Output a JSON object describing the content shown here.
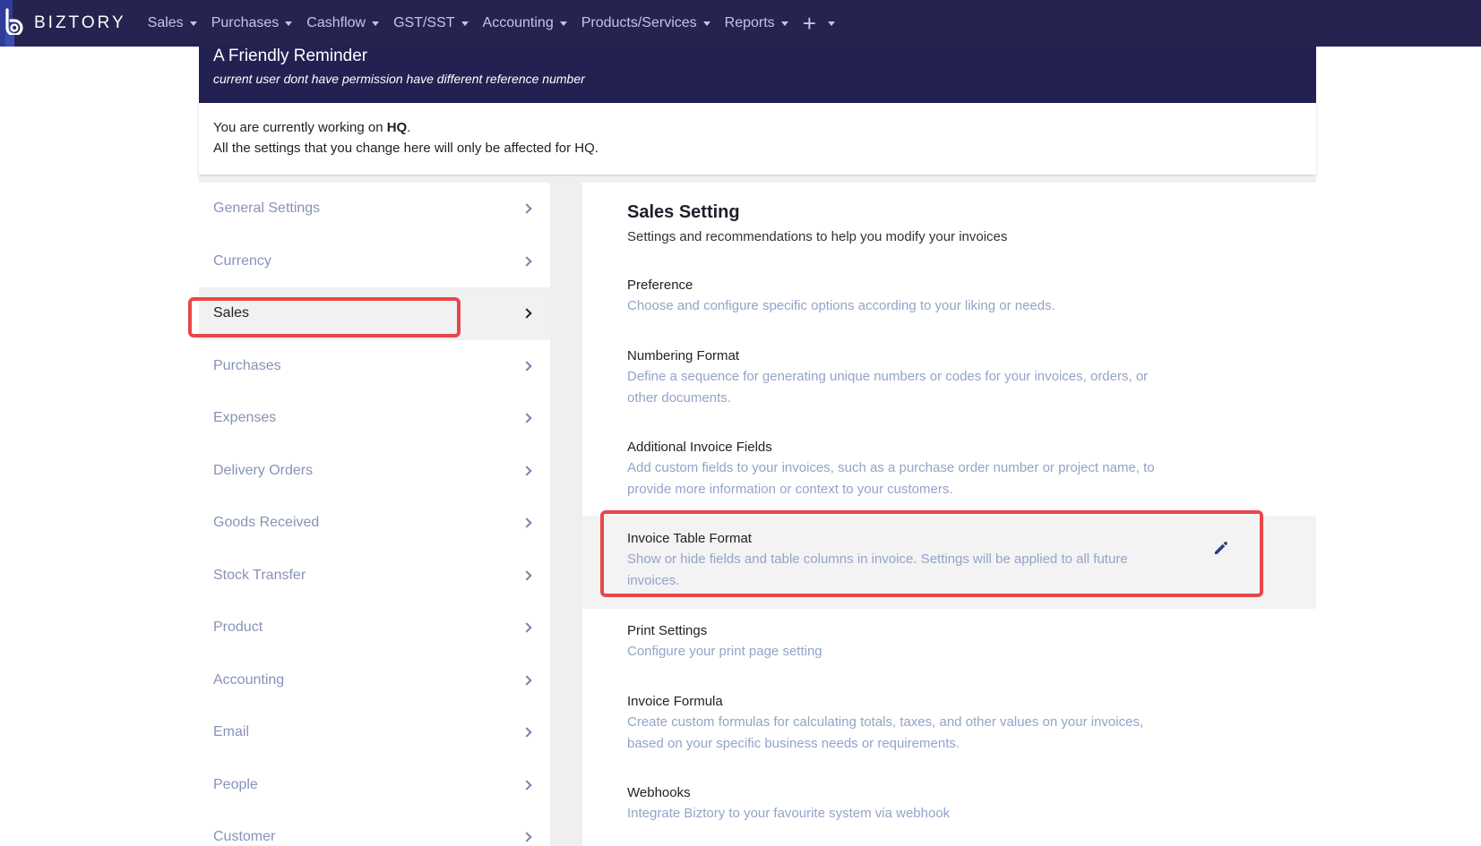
{
  "brand": {
    "name": "BIZTORY"
  },
  "nav": {
    "items": [
      {
        "label": "Sales"
      },
      {
        "label": "Purchases"
      },
      {
        "label": "Cashflow"
      },
      {
        "label": "GST/SST"
      },
      {
        "label": "Accounting"
      },
      {
        "label": "Products/Services"
      },
      {
        "label": "Reports"
      }
    ],
    "plus_label": "+"
  },
  "reminder": {
    "title": "A Friendly Reminder",
    "message": "current user dont have permission have different reference number"
  },
  "info": {
    "prefix": "You are currently working on ",
    "branch": "HQ",
    "suffix": ".",
    "line2": "All the settings that you change here will only be affected for HQ."
  },
  "sidebar": {
    "items": [
      {
        "label": "General Settings"
      },
      {
        "label": "Currency"
      },
      {
        "label": "Sales",
        "active": true
      },
      {
        "label": "Purchases"
      },
      {
        "label": "Expenses"
      },
      {
        "label": "Delivery Orders"
      },
      {
        "label": "Goods Received"
      },
      {
        "label": "Stock Transfer"
      },
      {
        "label": "Product"
      },
      {
        "label": "Accounting"
      },
      {
        "label": "Email"
      },
      {
        "label": "People"
      },
      {
        "label": "Customer"
      }
    ]
  },
  "main": {
    "title": "Sales Setting",
    "subtitle": "Settings and recommendations to help you modify your invoices",
    "settings": [
      {
        "title": "Preference",
        "desc": "Choose and configure specific options according to your liking or needs."
      },
      {
        "title": "Numbering Format",
        "desc": "Define a sequence for generating unique numbers or codes for your invoices, orders, or other documents."
      },
      {
        "title": "Additional Invoice Fields",
        "desc": "Add custom fields to your invoices, such as a purchase order number or project name, to provide more information or context to your customers."
      },
      {
        "title": "Invoice Table Format",
        "desc": "Show or hide fields and table columns in invoice. Settings will be applied to all future invoices."
      },
      {
        "title": "Print Settings",
        "desc": "Configure your print page setting"
      },
      {
        "title": "Invoice Formula",
        "desc": "Create custom formulas for calculating totals, taxes, and other values on your invoices, based on your specific business needs or requirements."
      },
      {
        "title": "Webhooks",
        "desc": "Integrate Biztory to your favourite system via webhook"
      }
    ]
  },
  "colors": {
    "navbar": "#252350",
    "banner": "#232152",
    "highlight_border": "#e8474a",
    "muted_text": "#94a3c8"
  }
}
